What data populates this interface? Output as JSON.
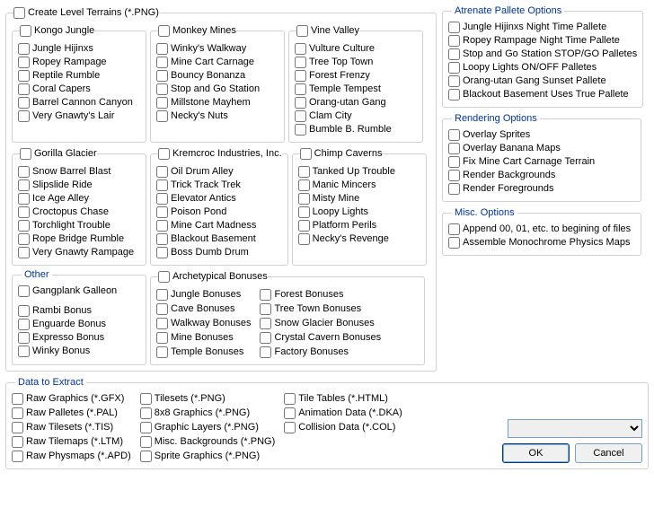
{
  "topCheck": "Create Level Terrains (*.PNG)",
  "worlds": [
    {
      "name": "Kongo Jungle",
      "items": [
        "Jungle Hijinxs",
        "Ropey Rampage",
        "Reptile Rumble",
        "Coral Capers",
        "Barrel Cannon Canyon",
        "Very Gnawty's Lair"
      ]
    },
    {
      "name": "Monkey Mines",
      "items": [
        "Winky's Walkway",
        "Mine Cart Carnage",
        "Bouncy Bonanza",
        "Stop and Go Station",
        "Millstone Mayhem",
        "Necky's Nuts"
      ]
    },
    {
      "name": "Vine Valley",
      "items": [
        "Vulture Culture",
        "Tree Top Town",
        "Forest Frenzy",
        "Temple Tempest",
        "Orang-utan Gang",
        "Clam City",
        "Bumble B. Rumble"
      ]
    },
    {
      "name": "Gorilla Glacier",
      "items": [
        "Snow Barrel Blast",
        "Slipslide Ride",
        "Ice Age Alley",
        "Croctopus Chase",
        "Torchlight Trouble",
        "Rope Bridge Rumble",
        "Very Gnawty Rampage"
      ]
    },
    {
      "name": "Kremcroc Industries, Inc.",
      "items": [
        "Oil Drum Alley",
        "Trick Track Trek",
        "Elevator Antics",
        "Poison Pond",
        "Mine Cart Madness",
        "Blackout Basement",
        "Boss Dumb Drum"
      ]
    },
    {
      "name": "Chimp Caverns",
      "items": [
        "Tanked Up Trouble",
        "Manic Mincers",
        "Misty Mine",
        "Loopy Lights",
        "Platform Perils",
        "Necky's Revenge"
      ]
    }
  ],
  "other": {
    "name": "Other",
    "items": [
      "Gangplank Galleon",
      "Rambi Bonus",
      "Enguarde Bonus",
      "Expresso Bonus",
      "Winky Bonus"
    ]
  },
  "bonuses": {
    "name": "Archetypical Bonuses",
    "col1": [
      "Jungle Bonuses",
      "Cave Bonuses",
      "Walkway Bonuses",
      "Mine Bonuses",
      "Temple Bonuses"
    ],
    "col2": [
      "Forest Bonuses",
      "Tree Town Bonuses",
      "Snow Glacier Bonuses",
      "Crystal Cavern Bonuses",
      "Factory Bonuses"
    ]
  },
  "palette": {
    "name": "Atrenate Pallete Options",
    "items": [
      "Jungle Hijinxs Night Time Pallete",
      "Ropey Rampage Night Time Pallete",
      "Stop and Go Station STOP/GO Palletes",
      "Loopy Lights ON/OFF Palletes",
      "Orang-utan Gang Sunset Pallete",
      "Blackout Basement Uses True Pallete"
    ]
  },
  "rendering": {
    "name": "Rendering Options",
    "items": [
      "Overlay Sprites",
      "Overlay Banana Maps",
      "Fix Mine Cart Carnage Terrain",
      "Render Backgrounds",
      "Render Foregrounds"
    ]
  },
  "misc": {
    "name": "Misc. Options",
    "items": [
      "Append 00, 01, etc. to begining of files",
      "Assemble Monochrome Physics Maps"
    ]
  },
  "extract": {
    "name": "Data to Extract",
    "col1": [
      "Raw Graphics (*.GFX)",
      "Raw Palletes (*.PAL)",
      "Raw Tilesets (*.TIS)",
      "Raw Tilemaps (*.LTM)",
      "Raw Physmaps (*.APD)"
    ],
    "col2": [
      "Tilesets (*.PNG)",
      "8x8 Graphics (*.PNG)",
      "Graphic Layers (*.PNG)",
      "Misc. Backgrounds (*.PNG)",
      "Sprite Graphics (*.PNG)"
    ],
    "col3": [
      "Tile Tables (*.HTML)",
      "Animation Data (*.DKA)",
      "Collision Data (*.COL)"
    ]
  },
  "buttons": {
    "ok": "OK",
    "cancel": "Cancel"
  }
}
